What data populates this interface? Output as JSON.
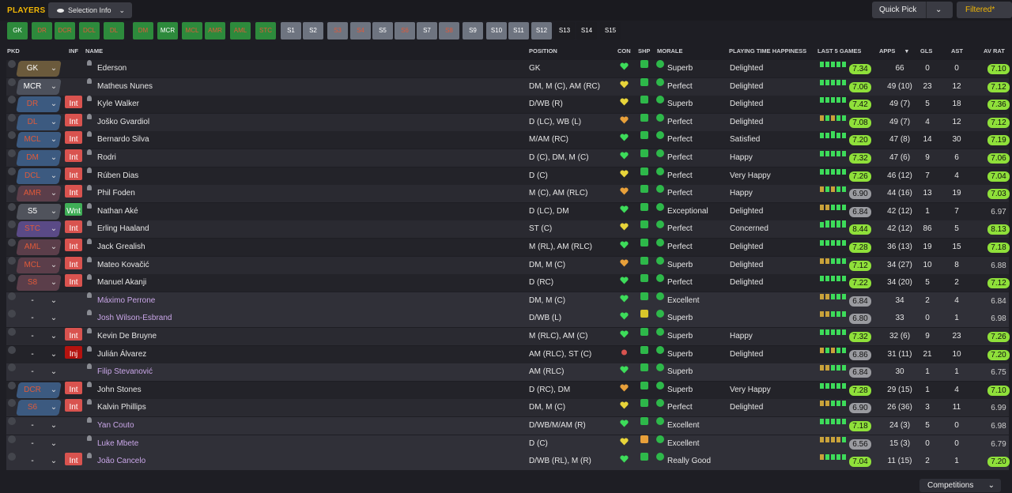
{
  "header": {
    "title": "PLAYERS",
    "selection_info": "Selection Info",
    "quick_pick": "Quick Pick",
    "filtered": "Filtered*"
  },
  "positions": [
    {
      "label": "GK",
      "state": "filled"
    },
    {
      "label": "DR",
      "state": "unfilled"
    },
    {
      "label": "DCR",
      "state": "unfilled"
    },
    {
      "label": "DCL",
      "state": "unfilled"
    },
    {
      "label": "DL",
      "state": "unfilled"
    },
    {
      "label": "DM",
      "state": "unfilled"
    },
    {
      "label": "MCR",
      "state": "filled"
    },
    {
      "label": "MCL",
      "state": "unfilled"
    },
    {
      "label": "AMR",
      "state": "unfilled"
    },
    {
      "label": "AML",
      "state": "unfilled"
    },
    {
      "label": "STC",
      "state": "unfilled"
    },
    {
      "label": "S1",
      "state": "sub"
    },
    {
      "label": "S2",
      "state": "sub"
    },
    {
      "label": "S3",
      "state": "sub-unfilled"
    },
    {
      "label": "S4",
      "state": "sub-unfilled"
    },
    {
      "label": "S5",
      "state": "sub"
    },
    {
      "label": "S6",
      "state": "sub-unfilled"
    },
    {
      "label": "S7",
      "state": "sub"
    },
    {
      "label": "S8",
      "state": "sub-unfilled"
    },
    {
      "label": "S9",
      "state": "sub"
    },
    {
      "label": "S10",
      "state": "sub"
    },
    {
      "label": "S11",
      "state": "sub"
    },
    {
      "label": "S12",
      "state": "sub"
    },
    {
      "label": "S13",
      "state": "empty"
    },
    {
      "label": "S14",
      "state": "empty"
    },
    {
      "label": "S15",
      "state": "empty"
    }
  ],
  "columns": {
    "pkd": "PKD",
    "inf": "INF",
    "name": "NAME",
    "position": "POSITION",
    "con": "CON",
    "shp": "SHP",
    "morale": "MORALE",
    "happiness": "PLAYING TIME HAPPINESS",
    "last5": "LAST 5 GAMES",
    "apps": "APPS",
    "gls": "GLS",
    "ast": "AST",
    "avrat": "AV RAT"
  },
  "colors": {
    "gold": "#f2b705",
    "green_pill": "#8fe03a",
    "gray_pill": "#9a9ba0",
    "int_tag": "#d9534f",
    "wnt_tag": "#3fae57",
    "inj_tag": "#b5130f"
  },
  "players": [
    {
      "sel": "GK",
      "sel_style": "gk",
      "inf": "",
      "name": "Ederson",
      "pos": "GK",
      "con": "green",
      "shp": "green",
      "morale": "Superb",
      "happy": "Delighted",
      "last5": "7.34",
      "l5g": true,
      "bars": "ggggg",
      "apps": "66",
      "gls": "0",
      "ast": "0",
      "avr": "7.10",
      "avrg": true,
      "dim": false
    },
    {
      "sel": "MCR",
      "sel_style": "mcr",
      "inf": "",
      "name": "Matheus Nunes",
      "pos": "DM, M (C), AM (RC)",
      "con": "yellow",
      "shp": "green",
      "morale": "Perfect",
      "happy": "Delighted",
      "last5": "7.06",
      "l5g": true,
      "bars": "ggggg",
      "apps": "49 (10)",
      "gls": "23",
      "ast": "12",
      "avr": "7.12",
      "avrg": true,
      "dim": false
    },
    {
      "sel": "DR",
      "sel_style": "blue",
      "inf": "Int",
      "name": "Kyle Walker",
      "pos": "D/WB (R)",
      "con": "yellow",
      "shp": "green",
      "morale": "Superb",
      "happy": "Delighted",
      "last5": "7.42",
      "l5g": true,
      "bars": "ggggg",
      "apps": "49 (7)",
      "gls": "5",
      "ast": "18",
      "avr": "7.36",
      "avrg": true,
      "dim": false
    },
    {
      "sel": "DL",
      "sel_style": "blue",
      "inf": "Int",
      "name": "Joško Gvardiol",
      "pos": "D (LC), WB (L)",
      "con": "orange",
      "shp": "green",
      "morale": "Perfect",
      "happy": "Delighted",
      "last5": "7.08",
      "l5g": true,
      "bars": "ogogg",
      "apps": "49 (7)",
      "gls": "4",
      "ast": "12",
      "avr": "7.12",
      "avrg": true,
      "dim": false
    },
    {
      "sel": "MCL",
      "sel_style": "blue",
      "inf": "Int",
      "name": "Bernardo Silva",
      "pos": "M/AM (RC)",
      "con": "green",
      "shp": "green",
      "morale": "Perfect",
      "happy": "Satisfied",
      "last5": "7.20",
      "l5g": true,
      "bars": "ggGgg",
      "apps": "47 (8)",
      "gls": "14",
      "ast": "30",
      "avr": "7.19",
      "avrg": true,
      "dim": false
    },
    {
      "sel": "DM",
      "sel_style": "blue",
      "inf": "Int",
      "name": "Rodri",
      "pos": "D (C), DM, M (C)",
      "con": "green",
      "shp": "green",
      "morale": "Perfect",
      "happy": "Happy",
      "last5": "7.32",
      "l5g": true,
      "bars": "ggggg",
      "apps": "47 (6)",
      "gls": "9",
      "ast": "6",
      "avr": "7.06",
      "avrg": true,
      "dim": false
    },
    {
      "sel": "DCL",
      "sel_style": "blue",
      "inf": "Int",
      "name": "Rúben Dias",
      "pos": "D (C)",
      "con": "yellow",
      "shp": "green",
      "morale": "Perfect",
      "happy": "Very Happy",
      "last5": "7.26",
      "l5g": true,
      "bars": "ggggg",
      "apps": "46 (12)",
      "gls": "7",
      "ast": "4",
      "avr": "7.04",
      "avrg": true,
      "dim": false
    },
    {
      "sel": "AMR",
      "sel_style": "red",
      "inf": "Int",
      "name": "Phil Foden",
      "pos": "M (C), AM (RLC)",
      "con": "orange",
      "shp": "green",
      "morale": "Perfect",
      "happy": "Happy",
      "last5": "6.90",
      "l5g": false,
      "bars": "ogogg",
      "apps": "44 (16)",
      "gls": "13",
      "ast": "19",
      "avr": "7.03",
      "avrg": true,
      "dim": false
    },
    {
      "sel": "S5",
      "sel_style": "gray",
      "inf": "Wnt",
      "name": "Nathan Aké",
      "pos": "D (LC), DM",
      "con": "green",
      "shp": "green",
      "morale": "Exceptional",
      "happy": "Delighted",
      "last5": "6.84",
      "l5g": false,
      "bars": "ooggg",
      "apps": "42 (12)",
      "gls": "1",
      "ast": "7",
      "avr": "6.97",
      "avrg": false,
      "dim": false
    },
    {
      "sel": "STC",
      "sel_style": "purple",
      "inf": "Int",
      "name": "Erling Haaland",
      "pos": "ST (C)",
      "con": "yellow",
      "shp": "green",
      "morale": "Perfect",
      "happy": "Concerned",
      "last5": "8.44",
      "l5g": true,
      "bars": "gGGGG",
      "apps": "42 (12)",
      "gls": "86",
      "ast": "5",
      "avr": "8.13",
      "avrg": true,
      "dim": false
    },
    {
      "sel": "AML",
      "sel_style": "red",
      "inf": "Int",
      "name": "Jack Grealish",
      "pos": "M (RL), AM (RLC)",
      "con": "green",
      "shp": "green",
      "morale": "Perfect",
      "happy": "Delighted",
      "last5": "7.28",
      "l5g": true,
      "bars": "ggggg",
      "apps": "36 (13)",
      "gls": "19",
      "ast": "15",
      "avr": "7.18",
      "avrg": true,
      "dim": false
    },
    {
      "sel": "MCL",
      "sel_style": "red",
      "inf": "Int",
      "name": "Mateo Kovačić",
      "pos": "DM, M (C)",
      "con": "orange",
      "shp": "green",
      "morale": "Superb",
      "happy": "Delighted",
      "last5": "7.12",
      "l5g": true,
      "bars": "ooggg",
      "apps": "34 (27)",
      "gls": "10",
      "ast": "8",
      "avr": "6.88",
      "avrg": false,
      "dim": false
    },
    {
      "sel": "S8",
      "sel_style": "red",
      "inf": "Int",
      "name": "Manuel Akanji",
      "pos": "D (RC)",
      "con": "green",
      "shp": "green",
      "morale": "Perfect",
      "happy": "Delighted",
      "last5": "7.22",
      "l5g": true,
      "bars": "ggggg",
      "apps": "34 (20)",
      "gls": "5",
      "ast": "2",
      "avr": "7.12",
      "avrg": true,
      "dim": false
    },
    {
      "sel": "-",
      "sel_style": "none",
      "inf": "",
      "name": "Máximo Perrone",
      "pos": "DM, M (C)",
      "con": "green",
      "shp": "green",
      "morale": "Excellent",
      "happy": "",
      "last5": "6.84",
      "l5g": false,
      "bars": "ooggg",
      "apps": "34",
      "gls": "2",
      "ast": "4",
      "avr": "6.84",
      "avrg": false,
      "dim": true
    },
    {
      "sel": "-",
      "sel_style": "none",
      "inf": "",
      "name": "Josh Wilson-Esbrand",
      "pos": "D/WB (L)",
      "con": "green",
      "shp": "yellow",
      "morale": "Superb",
      "happy": "",
      "last5": "6.80",
      "l5g": false,
      "bars": "ooggg",
      "apps": "33",
      "gls": "0",
      "ast": "1",
      "avr": "6.98",
      "avrg": false,
      "dim": true
    },
    {
      "sel": "-",
      "sel_style": "none",
      "inf": "Int",
      "name": "Kevin De Bruyne",
      "pos": "M (RLC), AM (C)",
      "con": "green",
      "shp": "green",
      "morale": "Superb",
      "happy": "Happy",
      "last5": "7.32",
      "l5g": true,
      "bars": "ggggg",
      "apps": "32 (6)",
      "gls": "9",
      "ast": "23",
      "avr": "7.26",
      "avrg": true,
      "dim": false
    },
    {
      "sel": "-",
      "sel_style": "none",
      "inf": "Inj",
      "name": "Julián Álvarez",
      "pos": "AM (RLC), ST (C)",
      "con": "injury",
      "shp": "green",
      "morale": "Superb",
      "happy": "Delighted",
      "last5": "6.86",
      "l5g": false,
      "bars": "ogogg",
      "apps": "31 (11)",
      "gls": "21",
      "ast": "10",
      "avr": "7.20",
      "avrg": true,
      "dim": false
    },
    {
      "sel": "-",
      "sel_style": "none",
      "inf": "",
      "name": "Filip Stevanović",
      "pos": "AM (RLC)",
      "con": "green",
      "shp": "green",
      "morale": "Superb",
      "happy": "",
      "last5": "6.84",
      "l5g": false,
      "bars": "ooggg",
      "apps": "30",
      "gls": "1",
      "ast": "1",
      "avr": "6.75",
      "avrg": false,
      "dim": true
    },
    {
      "sel": "DCR",
      "sel_style": "blue",
      "inf": "Int",
      "name": "John Stones",
      "pos": "D (RC), DM",
      "con": "orange",
      "shp": "green",
      "morale": "Superb",
      "happy": "Very Happy",
      "last5": "7.28",
      "l5g": true,
      "bars": "ggggg",
      "apps": "29 (15)",
      "gls": "1",
      "ast": "4",
      "avr": "7.10",
      "avrg": true,
      "dim": false
    },
    {
      "sel": "S6",
      "sel_style": "blue",
      "inf": "Int",
      "name": "Kalvin Phillips",
      "pos": "DM, M (C)",
      "con": "yellow",
      "shp": "green",
      "morale": "Perfect",
      "happy": "Delighted",
      "last5": "6.90",
      "l5g": false,
      "bars": "ooggg",
      "apps": "26 (36)",
      "gls": "3",
      "ast": "11",
      "avr": "6.99",
      "avrg": false,
      "dim": false
    },
    {
      "sel": "-",
      "sel_style": "none",
      "inf": "",
      "name": "Yan Couto",
      "pos": "D/WB/M/AM (R)",
      "con": "green",
      "shp": "green",
      "morale": "Excellent",
      "happy": "",
      "last5": "7.18",
      "l5g": true,
      "bars": "ggggg",
      "apps": "24 (3)",
      "gls": "5",
      "ast": "0",
      "avr": "6.98",
      "avrg": false,
      "dim": true
    },
    {
      "sel": "-",
      "sel_style": "none",
      "inf": "",
      "name": "Luke Mbete",
      "pos": "D (C)",
      "con": "yellow",
      "shp": "orange",
      "morale": "Excellent",
      "happy": "",
      "last5": "6.56",
      "l5g": false,
      "bars": "oooog",
      "apps": "15 (3)",
      "gls": "0",
      "ast": "0",
      "avr": "6.79",
      "avrg": false,
      "dim": true
    },
    {
      "sel": "-",
      "sel_style": "none",
      "inf": "Int",
      "name": "João Cancelo",
      "pos": "D/WB (RL), M (R)",
      "con": "green",
      "shp": "green",
      "morale": "Really Good",
      "happy": "",
      "last5": "7.04",
      "l5g": true,
      "bars": "ogggg",
      "apps": "11 (15)",
      "gls": "2",
      "ast": "1",
      "avr": "7.20",
      "avrg": true,
      "dim": true
    }
  ],
  "footer": {
    "competitions": "Competitions"
  }
}
